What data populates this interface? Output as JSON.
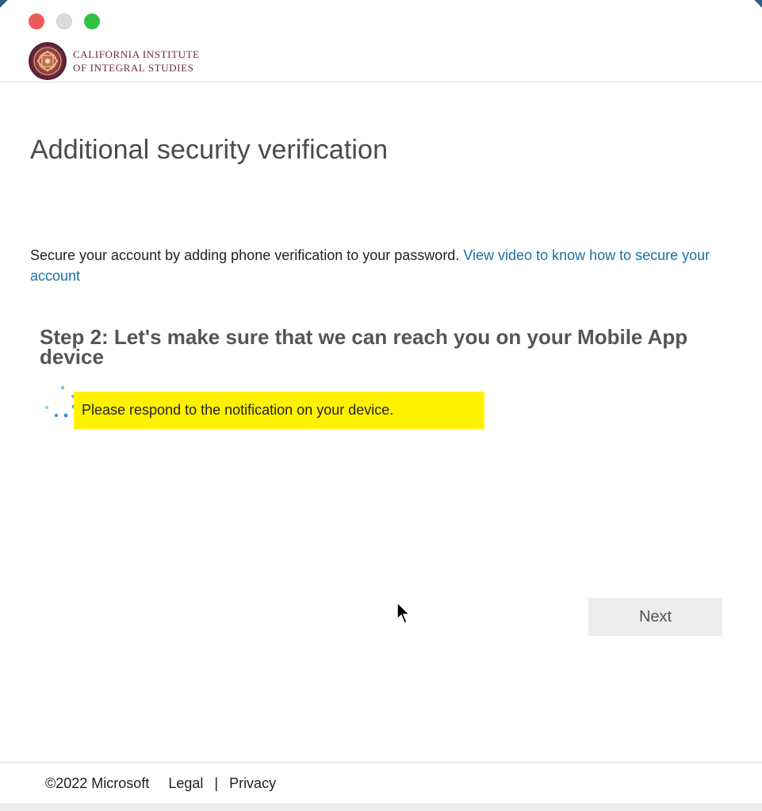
{
  "header": {
    "org_name_line1": "California Institute",
    "org_name_line2": "of Integral Studies"
  },
  "main": {
    "title": "Additional security verification",
    "intro_text": "Secure your account by adding phone verification to your password.",
    "intro_link": "View video to know how to secure your account",
    "step_title": "Step 2: Let's make sure that we can reach you on your Mobile App device",
    "notice": "Please respond to the notification on your device.",
    "next_label": "Next"
  },
  "footer": {
    "copyright": "©2022 Microsoft",
    "legal": "Legal",
    "separator": "|",
    "privacy": "Privacy"
  },
  "icons": {
    "logo": "mandala-logo-icon",
    "spinner": "loading-dots-icon",
    "cursor": "mouse-pointer-icon"
  },
  "colors": {
    "link": "#1f6fa8",
    "highlight": "#fff201",
    "brand": "#6c2a3e",
    "button_bg": "#ededed"
  }
}
